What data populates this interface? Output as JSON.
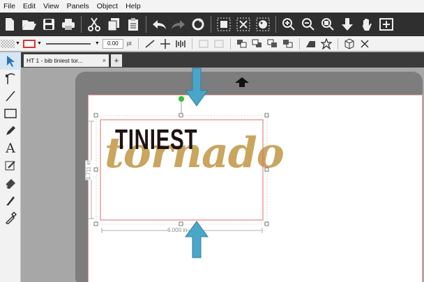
{
  "menu": {
    "items": [
      "File",
      "Edit",
      "View",
      "Panels",
      "Object",
      "Help"
    ]
  },
  "toolbar2": {
    "stroke_width": "0.00",
    "stroke_unit": "pt"
  },
  "tabs": {
    "doc_title": "HT 1 - bib tiniest tor...",
    "close": "×",
    "add": "+"
  },
  "design": {
    "line1": "TINIEST",
    "line2": "tornado"
  },
  "dimensions": {
    "height": "3.711 in",
    "width": "6.000 in"
  },
  "colors": {
    "text_dark": "#1f1212",
    "text_gold": "#c9a55e",
    "arrow": "#4aa6c8",
    "selection": "#e06d6d",
    "node": "#2ec42e"
  },
  "icons": {
    "toolbar1": [
      "new-icon",
      "open-icon",
      "save-icon",
      "print-icon",
      "cut-icon",
      "copy-icon",
      "paste-icon",
      "undo-icon",
      "redo-icon",
      "refresh-icon",
      "group-icon",
      "ungroup-icon",
      "fill-icon",
      "zoom-in-icon",
      "zoom-out-icon",
      "zoom-select-icon",
      "move-down-icon",
      "pan-hand-icon",
      "fit-page-icon"
    ],
    "left_tools": [
      "select-arrow-icon",
      "node-edit-icon",
      "line-icon",
      "rectangle-icon",
      "pencil-icon",
      "text-icon",
      "draw-shape-icon",
      "eraser-icon",
      "knife-icon",
      "eyedropper-icon"
    ]
  }
}
